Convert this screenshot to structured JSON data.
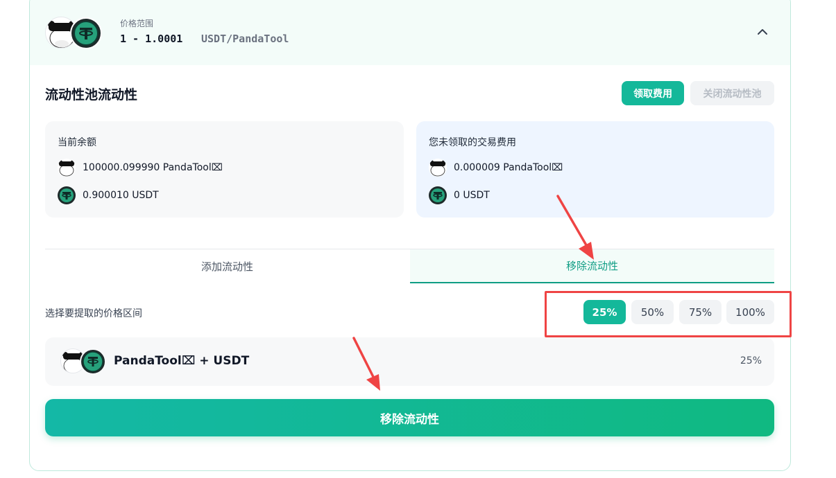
{
  "header": {
    "range_label": "价格范围",
    "range_value": "1 - 1.0001",
    "pair_unit": "USDT/PandaTool"
  },
  "section": {
    "title": "流动性池流动性",
    "collect_fees_label": "领取费用",
    "close_pool_label": "关闭流动性池"
  },
  "current_balance": {
    "title": "当前余额",
    "token1": "100000.099990 PandaTool⌧",
    "token2": "0.900010 USDT"
  },
  "unclaimed_fees": {
    "title": "您未领取的交易费用",
    "token1": "0.000009 PandaTool⌧",
    "token2": "0 USDT"
  },
  "tabs": [
    {
      "label": "添加流动性",
      "active": false
    },
    {
      "label": "移除流动性",
      "active": true
    }
  ],
  "range_select": {
    "label": "选择要提取的价格区间",
    "options": [
      "25%",
      "50%",
      "75%",
      "100%"
    ],
    "selected": "25%"
  },
  "pair": {
    "name": "PandaTool⌧ + USDT",
    "percent": "25%"
  },
  "remove_button_label": "移除流动性",
  "colors": {
    "accent": "#14b89a",
    "highlight": "#ef4444",
    "balance_bg": "#f7f8f9",
    "fees_bg": "#eef5ff"
  }
}
